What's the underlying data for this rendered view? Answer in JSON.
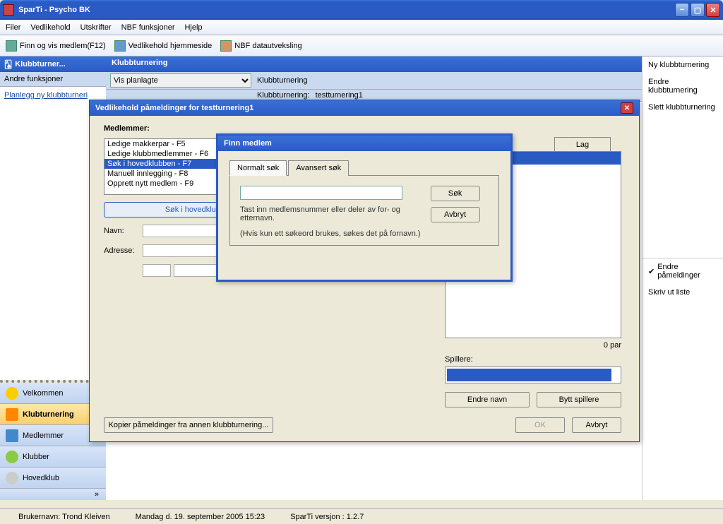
{
  "title": "SparTi - Psycho BK",
  "menu": {
    "filer": "Filer",
    "vedlikehold": "Vedlikehold",
    "utskrifter": "Utskrifter",
    "nbf": "NBF funksjoner",
    "hjelp": "Hjelp"
  },
  "toolbar": {
    "finn": "Finn og vis medlem(F12)",
    "vedl": "Vedlikehold hjemmeside",
    "nbf": "NBF datautveksling"
  },
  "left": {
    "header": "Klubbturner...",
    "sub": "Andre funksjoner",
    "link": "Planlegg ny klubbturneri",
    "nav": {
      "velkommen": "Velkommen",
      "klubb": "Klubturnering",
      "medlemmer": "Medlemmer",
      "klubber": "Klubber",
      "hovedklub": "Hovedklub"
    }
  },
  "center": {
    "header": "Klubbturnering",
    "dropdown": "Vis planlagte",
    "tlabel": "Klubbturnering",
    "trow_label": "Klubbturnering:",
    "trow_val": "testturnering1"
  },
  "right": {
    "ny": "Ny klubbturnering",
    "endre": "Endre klubbturnering",
    "slett": "Slett klubbturnering",
    "endrep": "Endre påmeldinger",
    "skriv": "Skriv ut liste"
  },
  "dialog1": {
    "title": "Vedlikehold påmeldinger for testturnering1",
    "medlemmer": "Medlemmer:",
    "list": [
      "Ledige makkerpar - F5",
      "Ledige klubbmedlemmer - F6",
      "Søk i hovedklubben - F7",
      "Manuell innlegging - F8",
      "Opprett nytt medlem - F9"
    ],
    "sokbtn": "Søk i hovedklubben",
    "navn": "Navn:",
    "adresse": "Adresse:",
    "lag": "Lag",
    "par": "0 par",
    "spillere": "Spillere:",
    "endrenavn": "Endre navn",
    "bytt": "Bytt spillere",
    "kopier": "Kopier påmeldinger fra annen klubbturnering...",
    "ok": "OK",
    "avbryt": "Avbryt"
  },
  "dialog2": {
    "title": "Finn medlem",
    "tab1": "Normalt søk",
    "tab2": "Avansert søk",
    "sok": "Søk",
    "avbryt": "Avbryt",
    "hint1": "Tast inn medlemsnummer eller deler av for- og etternavn.",
    "hint2": "(Hvis kun ett søkeord brukes, søkes det på fornavn.)"
  },
  "status": {
    "user": "Brukernavn: Trond Kleiven",
    "date": "Mandag d. 19. september 2005 15:23",
    "ver": "SparTi versjon : 1.2.7"
  }
}
